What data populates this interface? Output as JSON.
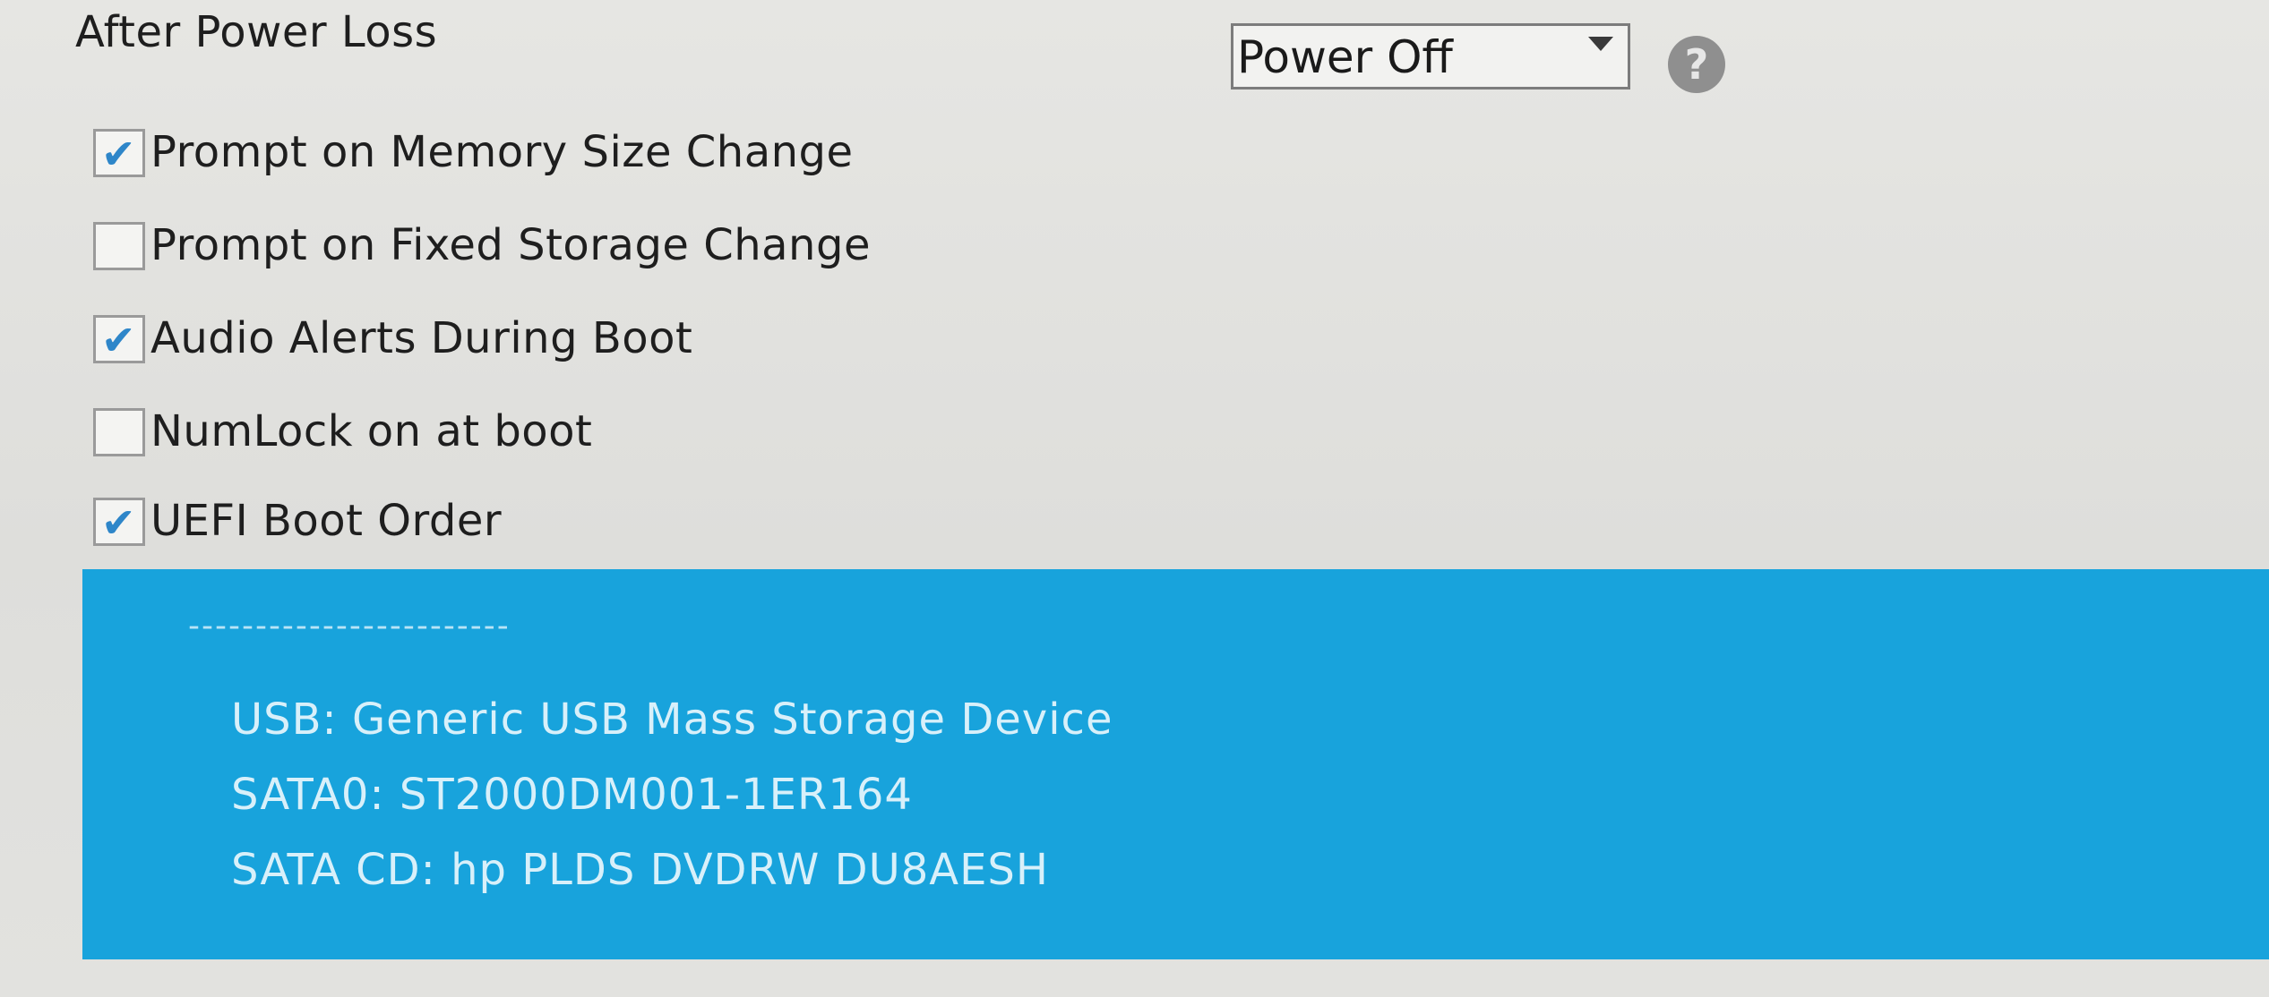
{
  "power": {
    "label": "After Power Loss",
    "selected": "Power Off",
    "help_glyph": "?"
  },
  "options": [
    {
      "label": "Prompt on Memory Size Change",
      "checked": true
    },
    {
      "label": "Prompt on Fixed Storage Change",
      "checked": false
    },
    {
      "label": "Audio Alerts During Boot",
      "checked": true
    },
    {
      "label": "NumLock on at boot",
      "checked": false
    },
    {
      "label": "UEFI Boot Order",
      "checked": true
    }
  ],
  "boot_order": {
    "separator": "------------------------",
    "items": [
      "USB:  Generic USB Mass Storage Device",
      "SATA0:  ST2000DM001-1ER164",
      "SATA CD:  hp PLDS DVDRW DU8AESH"
    ]
  },
  "colors": {
    "panel": "#18a3dc",
    "checkmark": "#2e86c9"
  },
  "icons": {
    "help": "help-icon",
    "check": "checkmark-icon",
    "dropdown": "chevron-down-icon"
  }
}
